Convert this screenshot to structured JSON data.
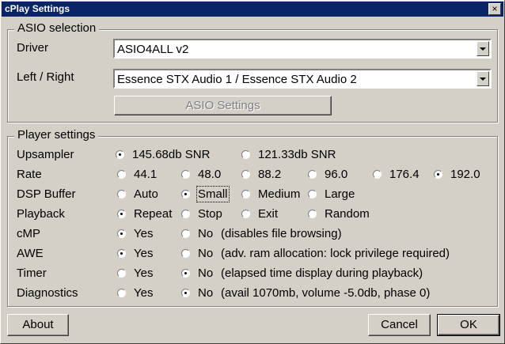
{
  "window": {
    "title": "cPlay Settings",
    "close_glyph": "×"
  },
  "asio": {
    "legend": "ASIO selection",
    "driver_label": "Driver",
    "driver_value": "ASIO4ALL v2",
    "lr_label": "Left / Right",
    "lr_value": "Essence STX Audio 1 / Essence STX Audio 2",
    "settings_button": "ASIO Settings"
  },
  "player": {
    "legend": "Player settings",
    "rows": [
      {
        "label": "Upsampler",
        "options": [
          "145.68db SNR",
          "121.33db SNR"
        ],
        "selected": 0
      },
      {
        "label": "Rate",
        "options": [
          "44.1",
          "48.0",
          "88.2",
          "96.0",
          "176.4",
          "192.0"
        ],
        "selected": 5
      },
      {
        "label": "DSP Buffer",
        "options": [
          "Auto",
          "Small",
          "Medium",
          "Large"
        ],
        "selected": 1
      },
      {
        "label": "Playback",
        "options": [
          "Repeat",
          "Stop",
          "Exit",
          "Random"
        ],
        "selected": 0
      },
      {
        "label": "cMP",
        "options": [
          "Yes",
          "No"
        ],
        "selected": 0,
        "note": "(disables file browsing)"
      },
      {
        "label": "AWE",
        "options": [
          "Yes",
          "No"
        ],
        "selected": 0,
        "note": "(adv. ram allocation: lock privilege required)"
      },
      {
        "label": "Timer",
        "options": [
          "Yes",
          "No"
        ],
        "selected": 1,
        "note": "(elapsed time display during playback)"
      },
      {
        "label": "Diagnostics",
        "options": [
          "Yes",
          "No"
        ],
        "selected": 1,
        "note": "(avail 1070mb, volume -5.0db, phase 0)"
      }
    ]
  },
  "buttons": {
    "about": "About",
    "cancel": "Cancel",
    "ok": "OK"
  }
}
